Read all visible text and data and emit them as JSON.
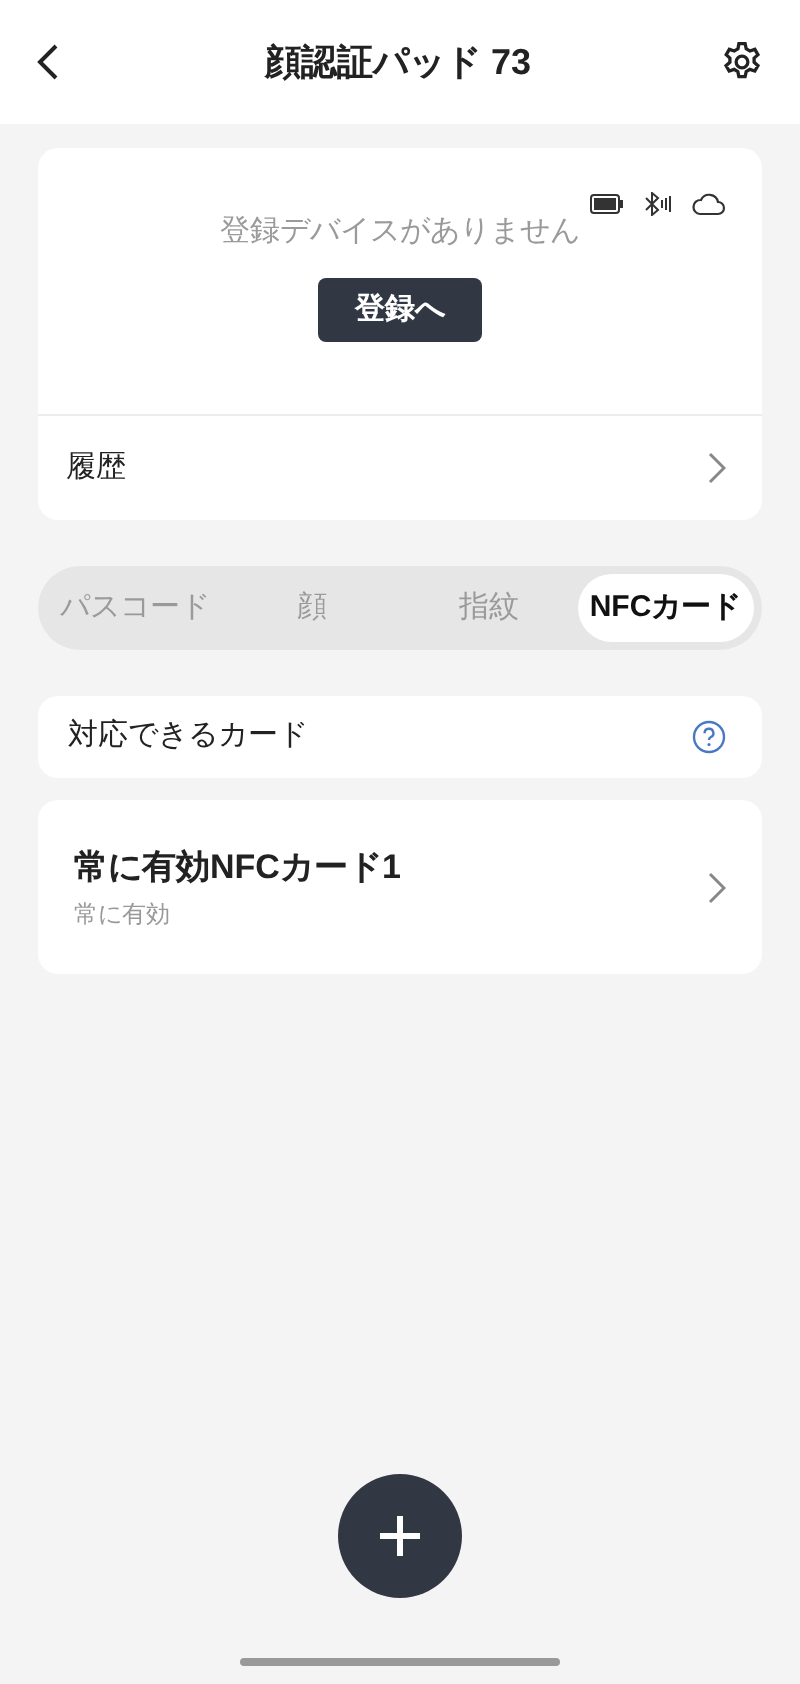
{
  "header": {
    "title": "顔認証パッド 73"
  },
  "device": {
    "message": "登録デバイスがありません",
    "button": "登録へ"
  },
  "history": {
    "label": "履歴"
  },
  "tabs": [
    {
      "label": "パスコード",
      "selected": false
    },
    {
      "label": "顔",
      "selected": false
    },
    {
      "label": "指紋",
      "selected": false
    },
    {
      "label": "NFCカード",
      "selected": true
    }
  ],
  "supported": {
    "label": "対応できるカード"
  },
  "cards": [
    {
      "title": "常に有効NFCカード1",
      "subtitle": "常に有効"
    }
  ]
}
